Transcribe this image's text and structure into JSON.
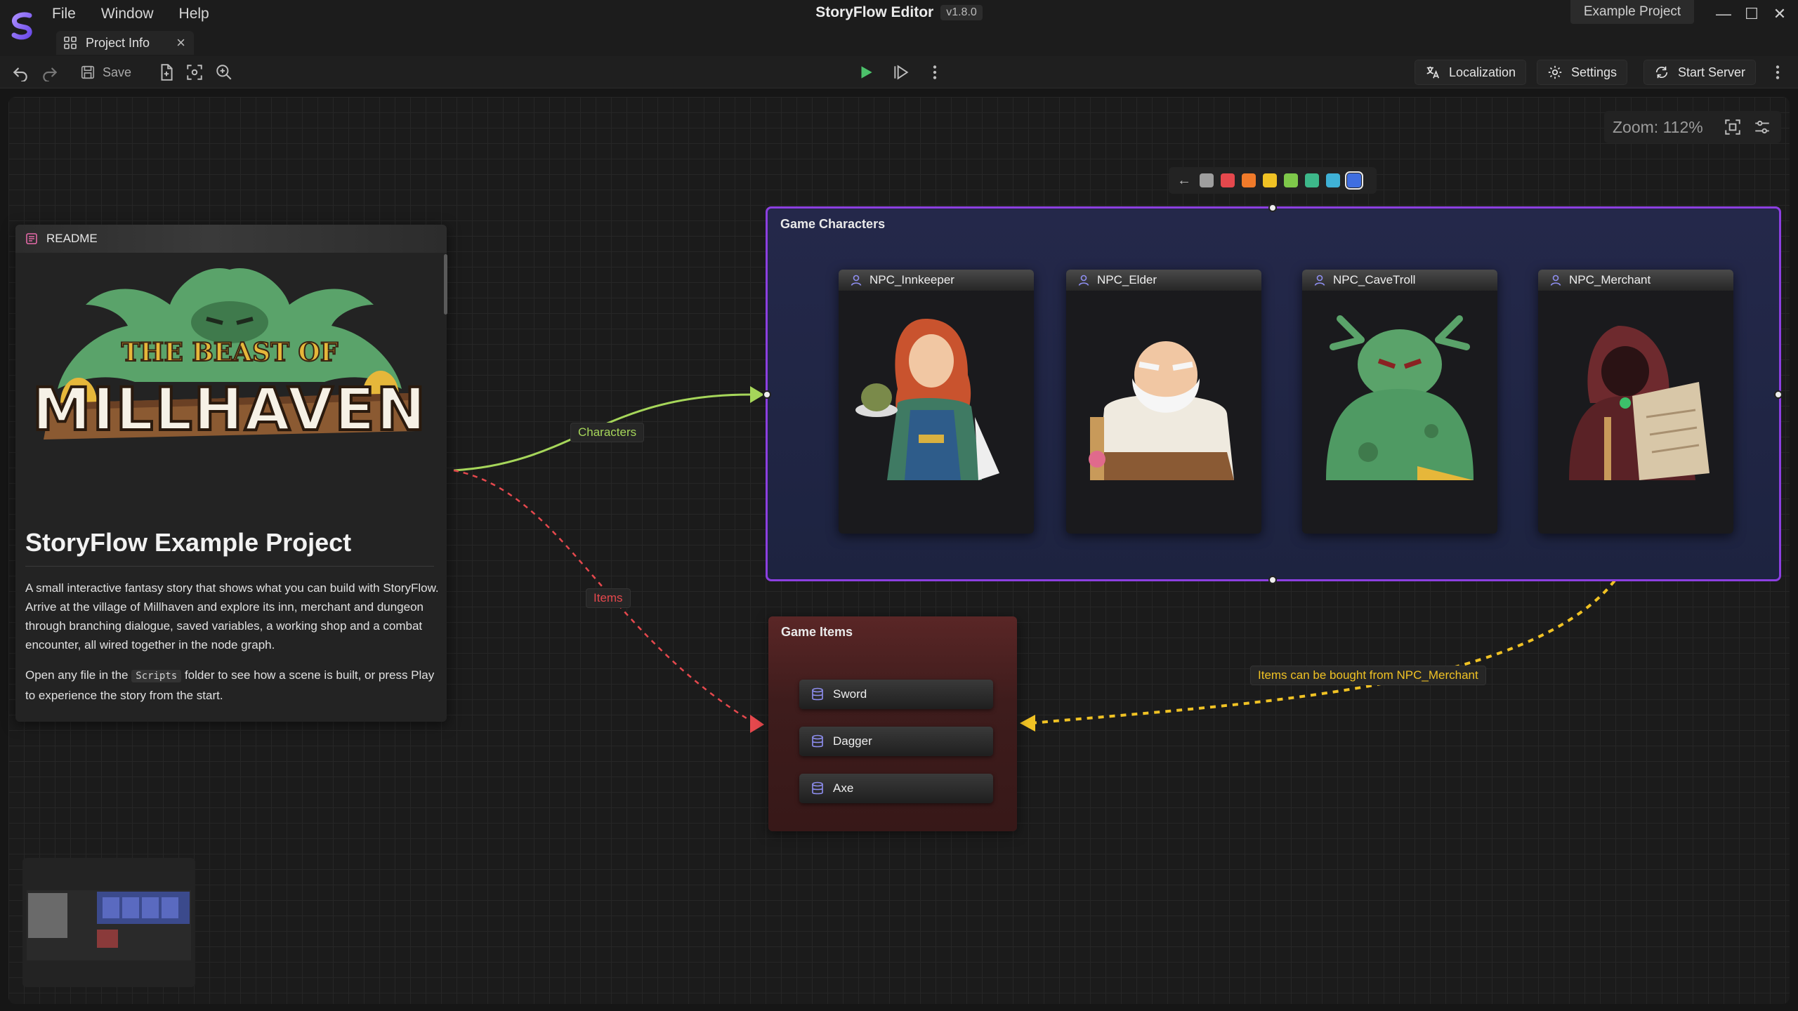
{
  "app": {
    "title": "StoryFlow Editor",
    "version": "v1.8.0",
    "project_name": "Example Project"
  },
  "menu": {
    "items": [
      "File",
      "Window",
      "Help"
    ]
  },
  "tab": {
    "label": "Project Info",
    "icon": "grid-icon"
  },
  "toolbar": {
    "save_label": "Save",
    "localization_label": "Localization",
    "settings_label": "Settings",
    "start_server_label": "Start Server"
  },
  "zoom": {
    "label": "Zoom: 112%"
  },
  "readme": {
    "header": "README",
    "title": "StoryFlow Example Project",
    "paragraph1": "A small interactive fantasy story that shows what you can build with StoryFlow. Arrive at the village of Millhaven and explore its inn, merchant and dungeon through branching dialogue, saved variables, a working shop and a combat encounter, all wired together in the node graph.",
    "paragraph2_before": "Open any file in the ",
    "paragraph2_code": "Scripts",
    "paragraph2_after": " folder to see how a scene is built, or press Play to experience the story from the start.",
    "logo_text_top": "THE BEAST OF",
    "logo_text_main": "MILLHAVEN"
  },
  "color_picker": {
    "swatches": [
      "#9e9e9e",
      "#e5484d",
      "#f07a2a",
      "#f0c224",
      "#7ec84a",
      "#3db88a",
      "#3fb1d6",
      "#3f6ee0"
    ],
    "selected_index": 7
  },
  "characters_group": {
    "title": "Game Characters",
    "border_color": "#8c3fe0",
    "characters": [
      {
        "name": "NPC_Innkeeper"
      },
      {
        "name": "NPC_Elder"
      },
      {
        "name": "NPC_CaveTroll"
      },
      {
        "name": "NPC_Merchant"
      }
    ]
  },
  "items_group": {
    "title": "Game Items",
    "items": [
      {
        "name": "Sword"
      },
      {
        "name": "Dagger"
      },
      {
        "name": "Axe"
      }
    ]
  },
  "edges": {
    "characters_label": "Characters",
    "characters_color": "#a6d65a",
    "items_label": "Items",
    "items_color": "#e5484d",
    "merchant_label": "Items can be bought from NPC_Merchant",
    "merchant_color": "#f0c224"
  }
}
